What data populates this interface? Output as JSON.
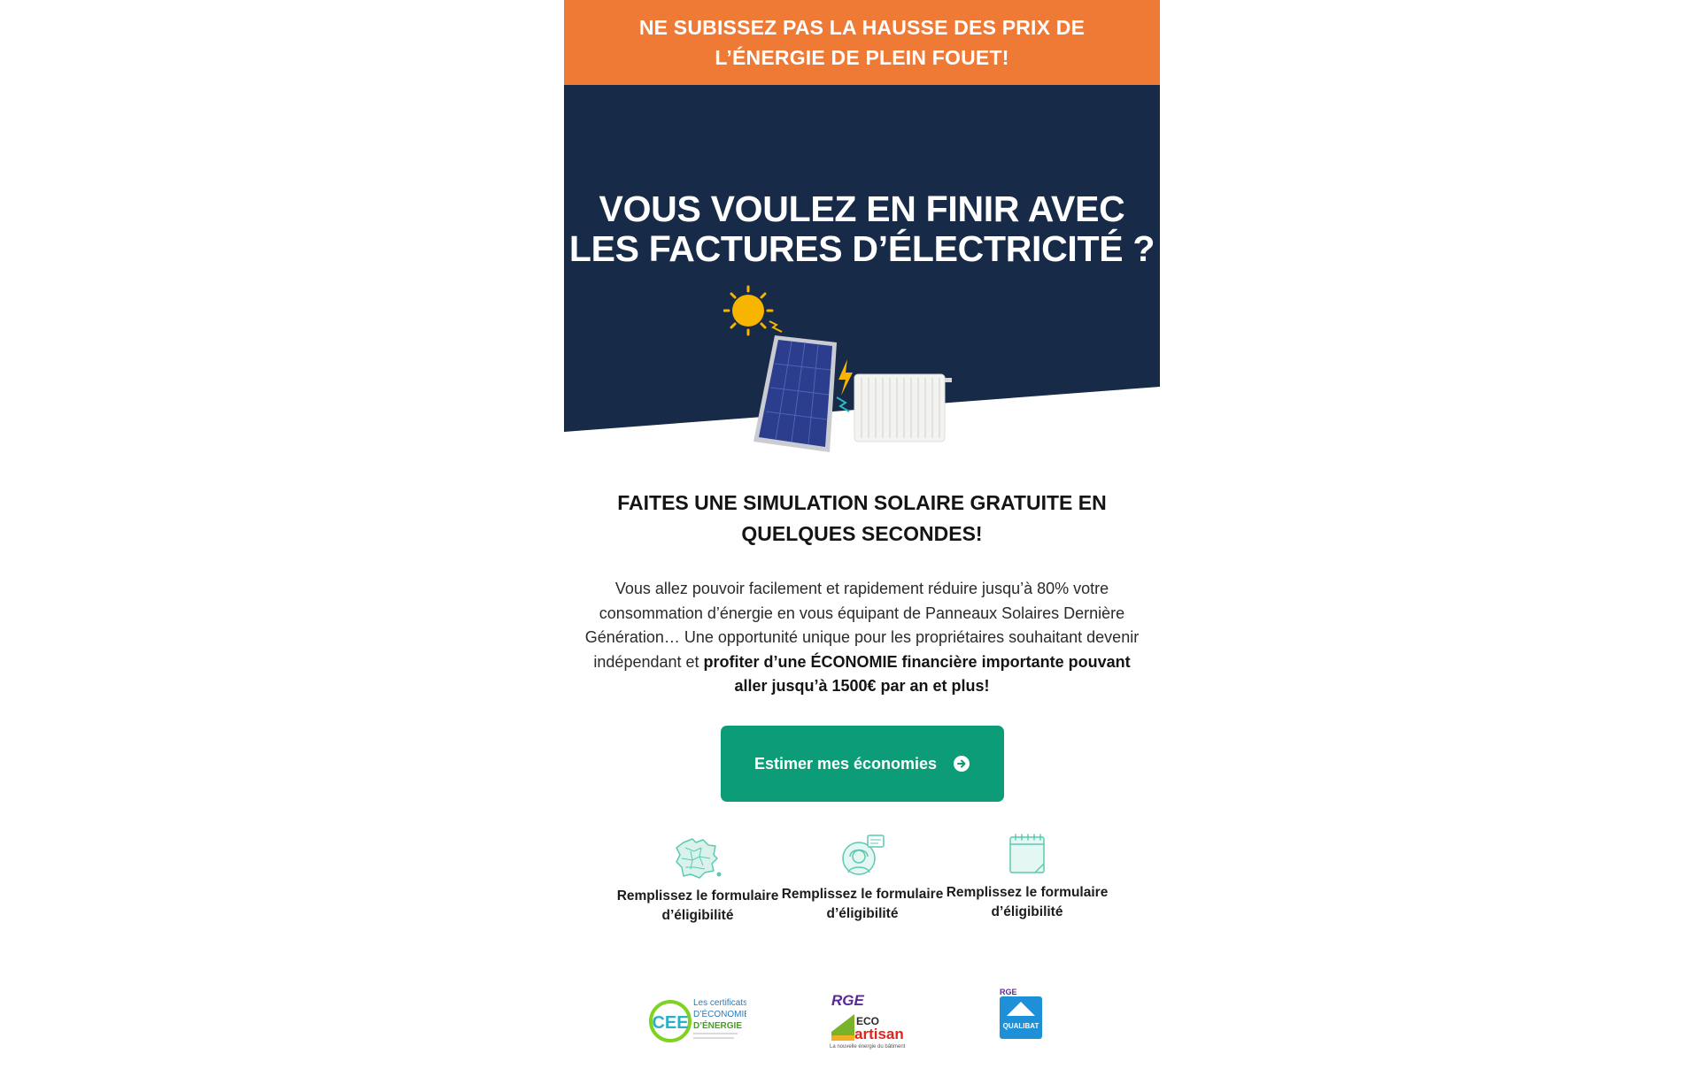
{
  "banner": {
    "text": "NE SUBISSEZ PAS LA HAUSSE DES PRIX DE L’ÉNERGIE DE PLEIN FOUET!"
  },
  "hero": {
    "title": "VOUS VOULEZ EN FINIR AVEC LES FACTURES D’ÉLECTRICITÉ ?"
  },
  "simulation": {
    "title": "FAITES UNE SIMULATION SOLAIRE GRATUITE EN QUELQUES SECONDES!",
    "text_regular": "Vous allez pouvoir facilement et rapidement réduire jusqu’à 80% votre consommation d’énergie en vous équipant de Panneaux Solaires Dernière Génération… Une opportunité unique pour les propriétaires souhaitant devenir indépendant et ",
    "text_bold": "profiter d’une ÉCONOMIE financière importante pouvant aller jusqu’à 1500€ par an et plus!"
  },
  "cta": {
    "label": "Estimer mes économies",
    "icon": "arrow-right-circle-icon"
  },
  "features": [
    {
      "label": "Remplissez le formulaire d’éligibilité",
      "icon": "france-map-icon"
    },
    {
      "label": "Remplissez le formulaire d’éligibilité",
      "icon": "support-agent-icon"
    },
    {
      "label": "Remplissez le formulaire d’éligibilité",
      "icon": "calendar-icon"
    }
  ],
  "logos": {
    "cee": {
      "badge": "CEE",
      "line1": "Les certificats",
      "line2": "D’ÉCONOMIES",
      "line3": "D’ÉNERGIE"
    },
    "rge_eco": {
      "rge": "RGE",
      "eco": "ECO",
      "artisan": "artisan",
      "tagline": "La nouvelle énergie du bâtiment"
    },
    "qualibat": {
      "rge": "RGE",
      "name": "QUALIBAT"
    }
  },
  "colors": {
    "banner": "#ef7a35",
    "hero_bg": "#172a47",
    "cta": "#0d9c78",
    "icon_teal": "#5cc9b2"
  }
}
